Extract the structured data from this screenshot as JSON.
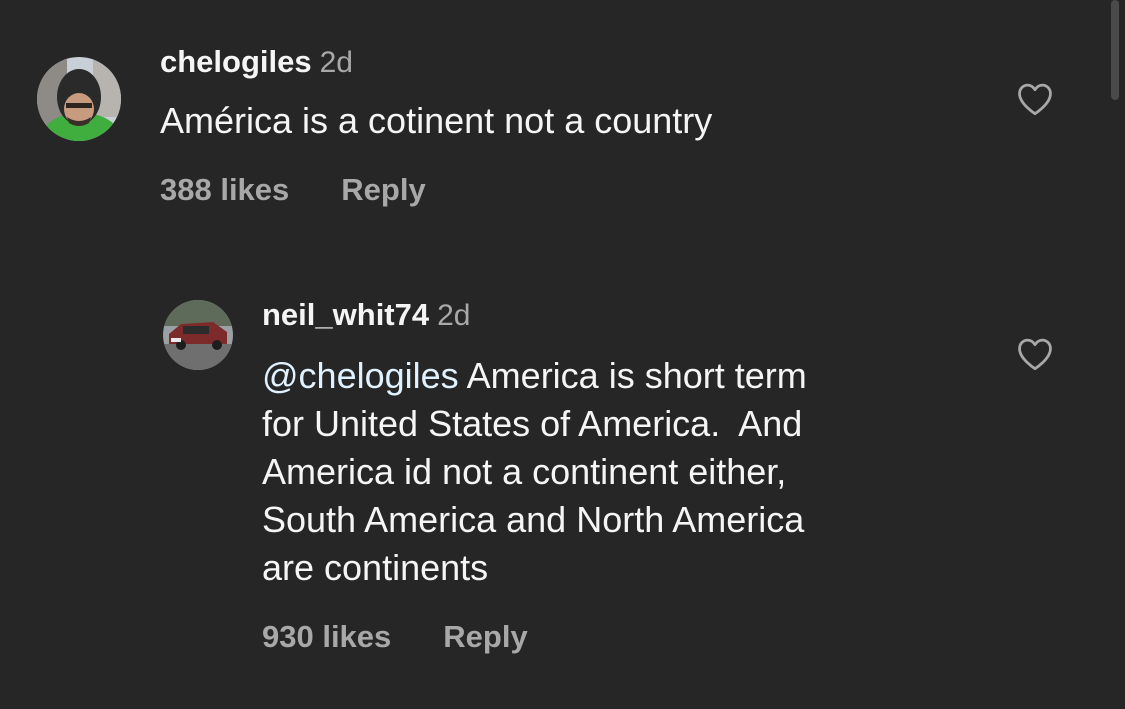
{
  "comments": [
    {
      "username": "chelogiles",
      "time": "2d",
      "text": "América is a cotinent not a country",
      "likes": "388 likes",
      "reply": "Reply"
    },
    {
      "username": "neil_whit74",
      "time": "2d",
      "mention": "@chelogiles",
      "lines": [
        " America is short term",
        "for United States of America.  And",
        "America id not a continent either,",
        "South America and North America",
        "are continents"
      ],
      "likes": "930 likes",
      "reply": "Reply"
    }
  ]
}
